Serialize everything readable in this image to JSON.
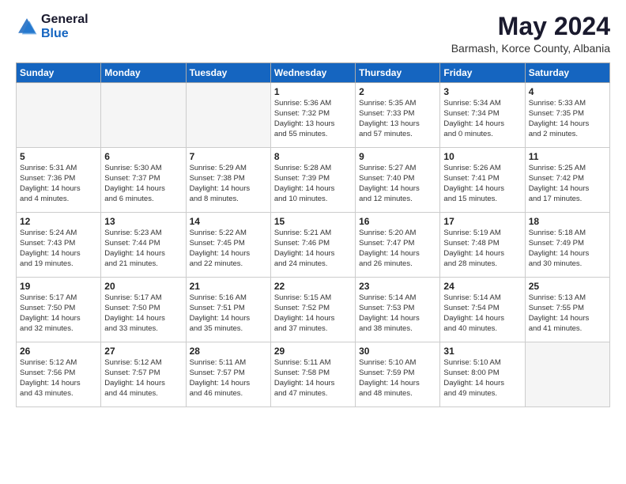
{
  "header": {
    "logo_general": "General",
    "logo_blue": "Blue",
    "month_year": "May 2024",
    "location": "Barmash, Korce County, Albania"
  },
  "weekdays": [
    "Sunday",
    "Monday",
    "Tuesday",
    "Wednesday",
    "Thursday",
    "Friday",
    "Saturday"
  ],
  "weeks": [
    [
      {
        "day": "",
        "info": ""
      },
      {
        "day": "",
        "info": ""
      },
      {
        "day": "",
        "info": ""
      },
      {
        "day": "1",
        "info": "Sunrise: 5:36 AM\nSunset: 7:32 PM\nDaylight: 13 hours\nand 55 minutes."
      },
      {
        "day": "2",
        "info": "Sunrise: 5:35 AM\nSunset: 7:33 PM\nDaylight: 13 hours\nand 57 minutes."
      },
      {
        "day": "3",
        "info": "Sunrise: 5:34 AM\nSunset: 7:34 PM\nDaylight: 14 hours\nand 0 minutes."
      },
      {
        "day": "4",
        "info": "Sunrise: 5:33 AM\nSunset: 7:35 PM\nDaylight: 14 hours\nand 2 minutes."
      }
    ],
    [
      {
        "day": "5",
        "info": "Sunrise: 5:31 AM\nSunset: 7:36 PM\nDaylight: 14 hours\nand 4 minutes."
      },
      {
        "day": "6",
        "info": "Sunrise: 5:30 AM\nSunset: 7:37 PM\nDaylight: 14 hours\nand 6 minutes."
      },
      {
        "day": "7",
        "info": "Sunrise: 5:29 AM\nSunset: 7:38 PM\nDaylight: 14 hours\nand 8 minutes."
      },
      {
        "day": "8",
        "info": "Sunrise: 5:28 AM\nSunset: 7:39 PM\nDaylight: 14 hours\nand 10 minutes."
      },
      {
        "day": "9",
        "info": "Sunrise: 5:27 AM\nSunset: 7:40 PM\nDaylight: 14 hours\nand 12 minutes."
      },
      {
        "day": "10",
        "info": "Sunrise: 5:26 AM\nSunset: 7:41 PM\nDaylight: 14 hours\nand 15 minutes."
      },
      {
        "day": "11",
        "info": "Sunrise: 5:25 AM\nSunset: 7:42 PM\nDaylight: 14 hours\nand 17 minutes."
      }
    ],
    [
      {
        "day": "12",
        "info": "Sunrise: 5:24 AM\nSunset: 7:43 PM\nDaylight: 14 hours\nand 19 minutes."
      },
      {
        "day": "13",
        "info": "Sunrise: 5:23 AM\nSunset: 7:44 PM\nDaylight: 14 hours\nand 21 minutes."
      },
      {
        "day": "14",
        "info": "Sunrise: 5:22 AM\nSunset: 7:45 PM\nDaylight: 14 hours\nand 22 minutes."
      },
      {
        "day": "15",
        "info": "Sunrise: 5:21 AM\nSunset: 7:46 PM\nDaylight: 14 hours\nand 24 minutes."
      },
      {
        "day": "16",
        "info": "Sunrise: 5:20 AM\nSunset: 7:47 PM\nDaylight: 14 hours\nand 26 minutes."
      },
      {
        "day": "17",
        "info": "Sunrise: 5:19 AM\nSunset: 7:48 PM\nDaylight: 14 hours\nand 28 minutes."
      },
      {
        "day": "18",
        "info": "Sunrise: 5:18 AM\nSunset: 7:49 PM\nDaylight: 14 hours\nand 30 minutes."
      }
    ],
    [
      {
        "day": "19",
        "info": "Sunrise: 5:17 AM\nSunset: 7:50 PM\nDaylight: 14 hours\nand 32 minutes."
      },
      {
        "day": "20",
        "info": "Sunrise: 5:17 AM\nSunset: 7:50 PM\nDaylight: 14 hours\nand 33 minutes."
      },
      {
        "day": "21",
        "info": "Sunrise: 5:16 AM\nSunset: 7:51 PM\nDaylight: 14 hours\nand 35 minutes."
      },
      {
        "day": "22",
        "info": "Sunrise: 5:15 AM\nSunset: 7:52 PM\nDaylight: 14 hours\nand 37 minutes."
      },
      {
        "day": "23",
        "info": "Sunrise: 5:14 AM\nSunset: 7:53 PM\nDaylight: 14 hours\nand 38 minutes."
      },
      {
        "day": "24",
        "info": "Sunrise: 5:14 AM\nSunset: 7:54 PM\nDaylight: 14 hours\nand 40 minutes."
      },
      {
        "day": "25",
        "info": "Sunrise: 5:13 AM\nSunset: 7:55 PM\nDaylight: 14 hours\nand 41 minutes."
      }
    ],
    [
      {
        "day": "26",
        "info": "Sunrise: 5:12 AM\nSunset: 7:56 PM\nDaylight: 14 hours\nand 43 minutes."
      },
      {
        "day": "27",
        "info": "Sunrise: 5:12 AM\nSunset: 7:57 PM\nDaylight: 14 hours\nand 44 minutes."
      },
      {
        "day": "28",
        "info": "Sunrise: 5:11 AM\nSunset: 7:57 PM\nDaylight: 14 hours\nand 46 minutes."
      },
      {
        "day": "29",
        "info": "Sunrise: 5:11 AM\nSunset: 7:58 PM\nDaylight: 14 hours\nand 47 minutes."
      },
      {
        "day": "30",
        "info": "Sunrise: 5:10 AM\nSunset: 7:59 PM\nDaylight: 14 hours\nand 48 minutes."
      },
      {
        "day": "31",
        "info": "Sunrise: 5:10 AM\nSunset: 8:00 PM\nDaylight: 14 hours\nand 49 minutes."
      },
      {
        "day": "",
        "info": ""
      }
    ]
  ]
}
